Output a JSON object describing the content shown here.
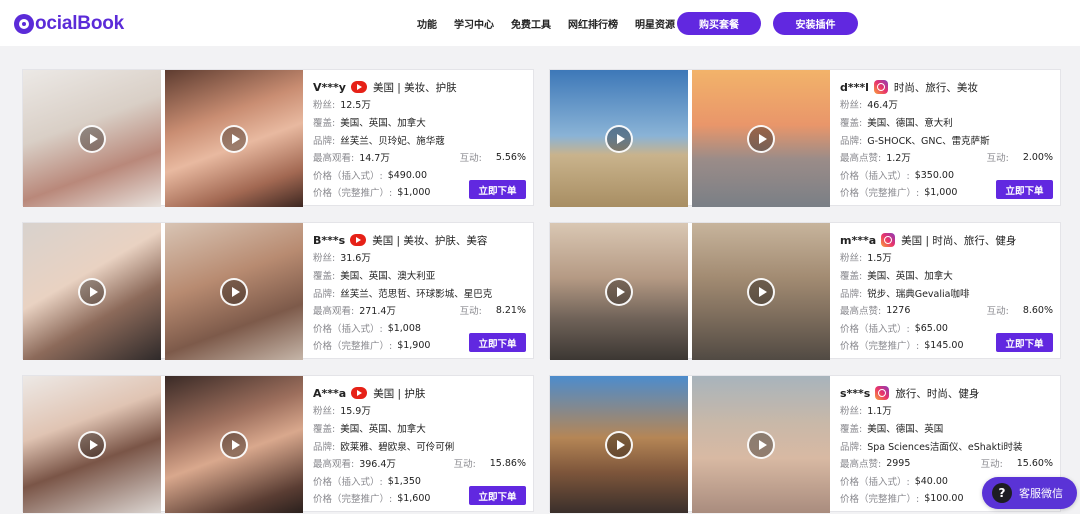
{
  "header": {
    "logo_text": "ocialBook",
    "nav": [
      "功能",
      "学习中心",
      "免费工具",
      "网红排行榜",
      "明星资源"
    ],
    "buy_label": "购买套餐",
    "install_label": "安装插件"
  },
  "colors": {
    "brand": "#6128e0",
    "youtube": "#e62117"
  },
  "labels": {
    "fans": "粉丝:",
    "coverage": "覆盖:",
    "brands": "品牌:",
    "interaction": "互动:",
    "price_insert": "价格（插入式）:",
    "price_full": "价格（完整推广）:",
    "order": "立即下单"
  },
  "cards": [
    {
      "handle": "V***y",
      "platform": "youtube-icon",
      "title": "美国 | 美妆、护肤",
      "fans": "12.5万",
      "coverage": "美国、英国、加拿大",
      "brands": "丝芙兰、贝玲妃、施华蔻",
      "stat_label": "最高观看:",
      "stat_value": "14.7万",
      "interaction": "5.56%",
      "price_insert": "$490.00",
      "price_full": "$1,000"
    },
    {
      "handle": "d***l",
      "platform": "instagram-icon",
      "title": "时尚、旅行、美妆",
      "fans": "46.4万",
      "coverage": "美国、德国、意大利",
      "brands": "G-SHOCK、GNC、雷克萨斯",
      "stat_label": "最高点赞:",
      "stat_value": "1.2万",
      "interaction": "2.00%",
      "price_insert": "$350.00",
      "price_full": "$1,000"
    },
    {
      "handle": "B***s",
      "platform": "youtube-icon",
      "title": "美国 | 美妆、护肤、美容",
      "fans": "31.6万",
      "coverage": "美国、英国、澳大利亚",
      "brands": "丝芙兰、范思哲、环球影城、星巴克",
      "stat_label": "最高观看:",
      "stat_value": "271.4万",
      "interaction": "8.21%",
      "price_insert": "$1,008",
      "price_full": "$1,900"
    },
    {
      "handle": "m***a",
      "platform": "instagram-icon",
      "title": "美国 | 时尚、旅行、健身",
      "fans": "1.5万",
      "coverage": "美国、英国、加拿大",
      "brands": "锐步、瑞典Gevalia咖啡",
      "stat_label": "最高点赞:",
      "stat_value": "1276",
      "interaction": "8.60%",
      "price_insert": "$65.00",
      "price_full": "$145.00"
    },
    {
      "handle": "A***a",
      "platform": "youtube-icon",
      "title": "美国 | 护肤",
      "fans": "15.9万",
      "coverage": "美国、英国、加拿大",
      "brands": "欧莱雅、碧欧泉、可伶可俐",
      "stat_label": "最高观看:",
      "stat_value": "396.4万",
      "interaction": "15.86%",
      "price_insert": "$1,350",
      "price_full": "$1,600"
    },
    {
      "handle": "s***s",
      "platform": "instagram-icon",
      "title": "旅行、时尚、健身",
      "fans": "1.1万",
      "coverage": "美国、德国、英国",
      "brands": "Spa Sciences洁面仪、eShakti时装",
      "stat_label": "最高点赞:",
      "stat_value": "2995",
      "interaction": "15.60%",
      "price_insert": "$40.00",
      "price_full": "$100.00"
    }
  ],
  "service": {
    "icon_glyph": "?",
    "label": "客服微信"
  }
}
